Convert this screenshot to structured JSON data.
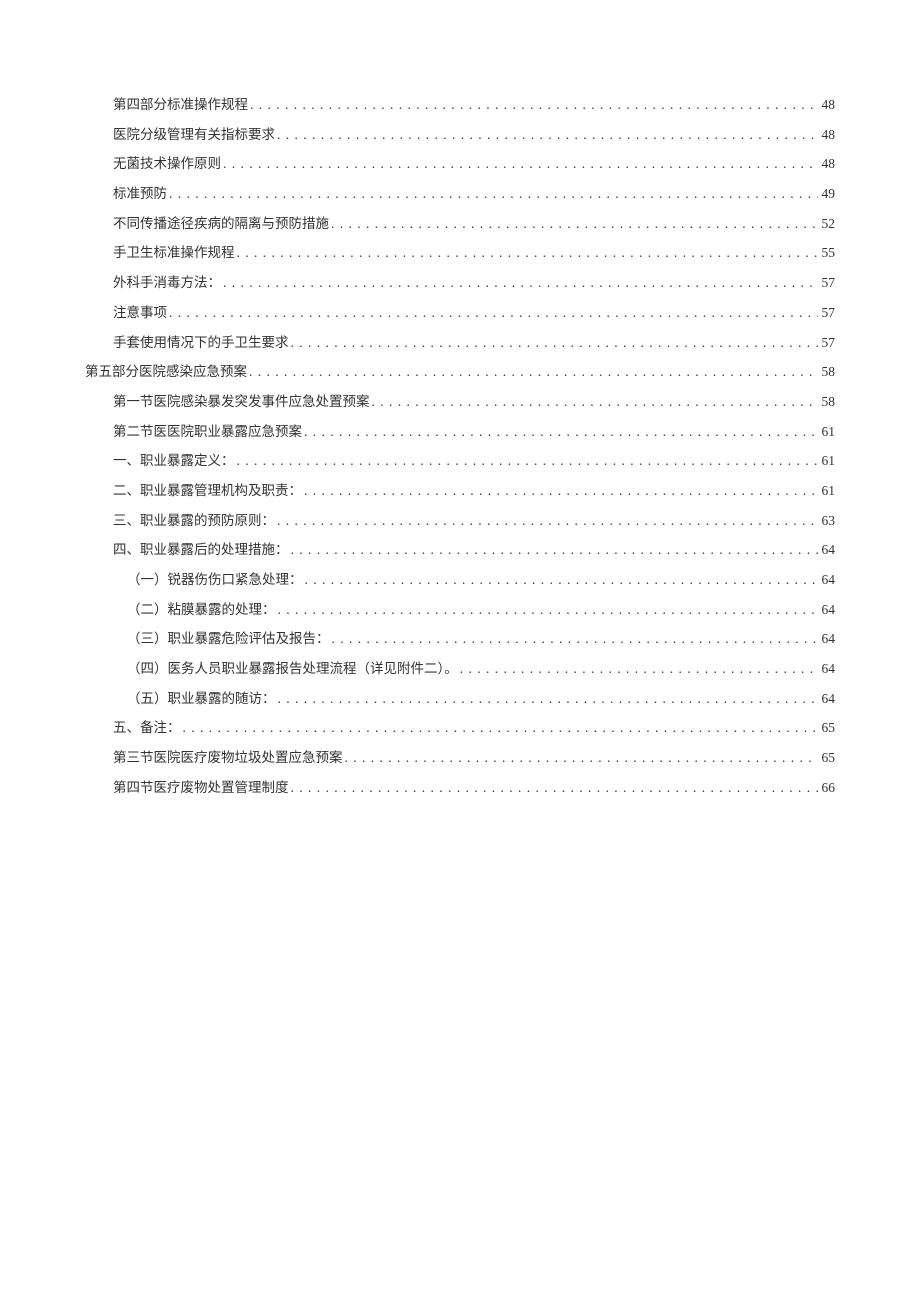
{
  "toc": [
    {
      "title": "第四部分标准操作规程",
      "page": "48",
      "indent": 1
    },
    {
      "title": "医院分级管理有关指标要求",
      "page": "48",
      "indent": 1
    },
    {
      "title": "无菌技术操作原则",
      "page": "48",
      "indent": 1
    },
    {
      "title": "标准预防",
      "page": "49",
      "indent": 1
    },
    {
      "title": "不同传播途径疾病的隔离与预防措施",
      "page": "52",
      "indent": 1
    },
    {
      "title": "手卫生标准操作规程",
      "page": "55",
      "indent": 1
    },
    {
      "title": "外科手消毒方法：",
      "page": "57",
      "indent": 1
    },
    {
      "title": "注意事项",
      "page": "57",
      "indent": 1
    },
    {
      "title": "手套使用情况下的手卫生要求",
      "page": "57",
      "indent": 1
    },
    {
      "title": "第五部分医院感染应急预案",
      "page": "58",
      "indent": 0
    },
    {
      "title": "第一节医院感染暴发突发事件应急处置预案",
      "page": "58",
      "indent": 1
    },
    {
      "title": "第二节医医院职业暴露应急预案",
      "page": "61",
      "indent": 1
    },
    {
      "title": "一、职业暴露定义：",
      "page": "61",
      "indent": 1
    },
    {
      "title": "二、职业暴露管理机构及职责：",
      "page": "61",
      "indent": 1
    },
    {
      "title": "三、职业暴露的预防原则：",
      "page": "63",
      "indent": 1
    },
    {
      "title": "四、职业暴露后的处理措施：",
      "page": "64",
      "indent": 1
    },
    {
      "title": "（一）锐器伤伤口紧急处理：",
      "page": "64",
      "indent": 2
    },
    {
      "title": "（二）粘膜暴露的处理：",
      "page": "64",
      "indent": 2
    },
    {
      "title": "（三）职业暴露危险评估及报告：",
      "page": "64",
      "indent": 2
    },
    {
      "title": "（四）医务人员职业暴露报告处理流程（详见附件二）。",
      "page": "64",
      "indent": 2
    },
    {
      "title": "（五）职业暴露的随访：",
      "page": "64",
      "indent": 2
    },
    {
      "title": "五、备注：",
      "page": "65",
      "indent": 1
    },
    {
      "title": "第三节医院医疗废物垃圾处置应急预案",
      "page": "65",
      "indent": 1
    },
    {
      "title": "第四节医疗废物处置管理制度",
      "page": "66",
      "indent": 1
    }
  ]
}
